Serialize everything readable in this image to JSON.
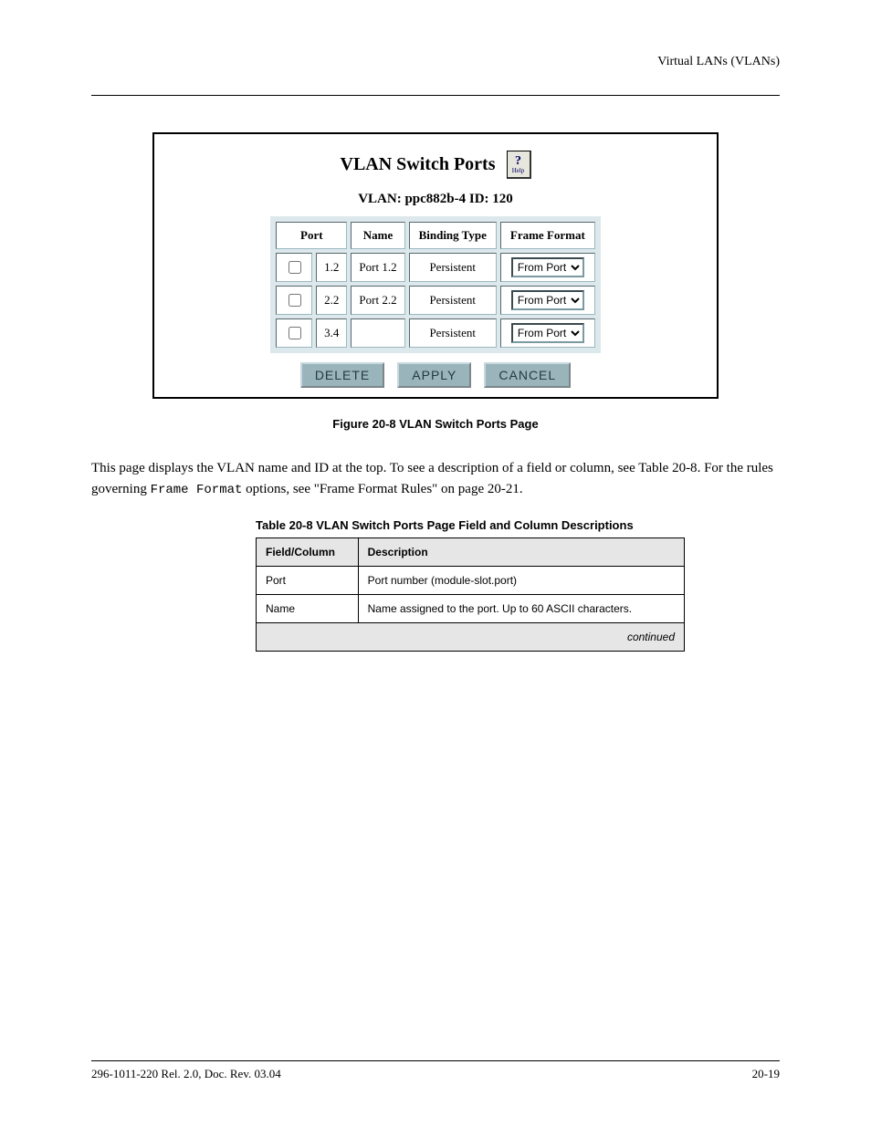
{
  "header": {
    "right": "Virtual LANs (VLANs)"
  },
  "figure": {
    "title": "VLAN Switch Ports",
    "help_label": "Help",
    "subtitle": "VLAN: ppc882b-4 ID: 120",
    "columns": {
      "port": "Port",
      "name": "Name",
      "binding": "Binding Type",
      "frame": "Frame Format"
    },
    "rows": [
      {
        "port": "1.2",
        "name": "Port 1.2",
        "binding": "Persistent",
        "frame": "From Port"
      },
      {
        "port": "2.2",
        "name": "Port 2.2",
        "binding": "Persistent",
        "frame": "From Port"
      },
      {
        "port": "3.4",
        "name": "",
        "binding": "Persistent",
        "frame": "From Port"
      }
    ],
    "buttons": {
      "delete": "DELETE",
      "apply": "APPLY",
      "cancel": "CANCEL"
    },
    "caption": "Figure 20-8   VLAN Switch Ports Page"
  },
  "paragraph": {
    "p1a": "This page displays the VLAN name and ID at the top. To see a description of a field or column, see ",
    "p1_link": "Table 20-8",
    "p1b": ". For the rules governing ",
    "p1_mono": "Frame Format",
    "p1c": " options, see \"Frame Format Rules\" on page 20-21."
  },
  "table": {
    "caption": "Table 20-8   VLAN Switch Ports Page Field and Column Descriptions",
    "head": {
      "field": "Field/Column",
      "desc": "Description"
    },
    "rows": [
      {
        "field": "Port",
        "desc": "Port number (module-slot.port)"
      },
      {
        "field": "Name",
        "desc": "Name assigned to the port. Up to 60 ASCII characters."
      }
    ],
    "continued": "continued"
  },
  "footer": {
    "left": "296-1011-220 Rel. 2.0, Doc. Rev. 03.04",
    "right": "20-19"
  }
}
